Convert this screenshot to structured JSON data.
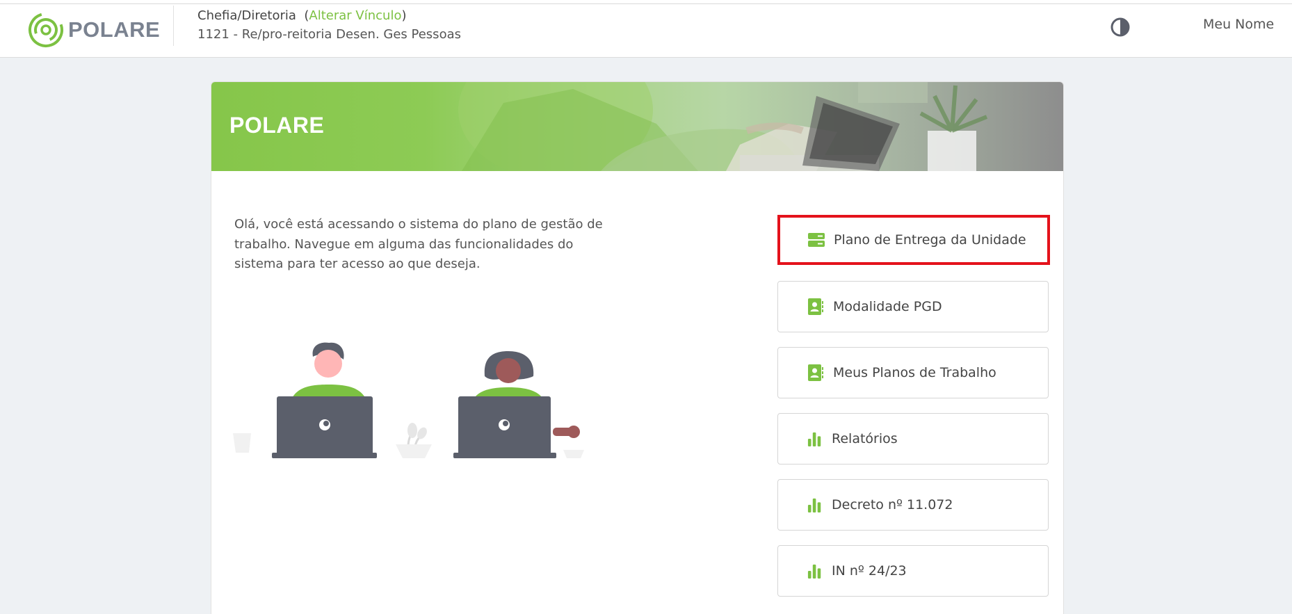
{
  "header": {
    "logo_text": "POLARE",
    "role": "Chefia/Diretoria",
    "change_link_open": "(",
    "change_link": "Alterar Vínculo",
    "change_link_close": ")",
    "unit": "1121 - Re/pro-reitoria Desen. Ges Pessoas",
    "theme_icon": "contrast-icon",
    "user_name": "Meu Nome"
  },
  "banner": {
    "title": "POLARE"
  },
  "main": {
    "intro_text": "Olá, você está acessando o sistema do plano de gestão de trabalho. Navegue em alguma das funcionalidades do sistema para ter acesso ao que deseja."
  },
  "menu": {
    "items": [
      {
        "label": "Plano de Entrega da Unidade",
        "icon": "server-icon",
        "highlighted": true
      },
      {
        "label": "Modalidade PGD",
        "icon": "contact-book-icon"
      },
      {
        "label": "Meus Planos de Trabalho",
        "icon": "contact-book-icon"
      },
      {
        "label": "Relatórios",
        "icon": "bar-chart-icon"
      },
      {
        "label": "Decreto nº 11.072",
        "icon": "bar-chart-icon"
      },
      {
        "label": "IN nº 24/23",
        "icon": "bar-chart-icon"
      }
    ]
  },
  "colors": {
    "brand_green": "#7cc142",
    "highlight_red": "#e4121b",
    "logo_gray": "#7a8290",
    "dark_gray": "#5b5f6b"
  }
}
